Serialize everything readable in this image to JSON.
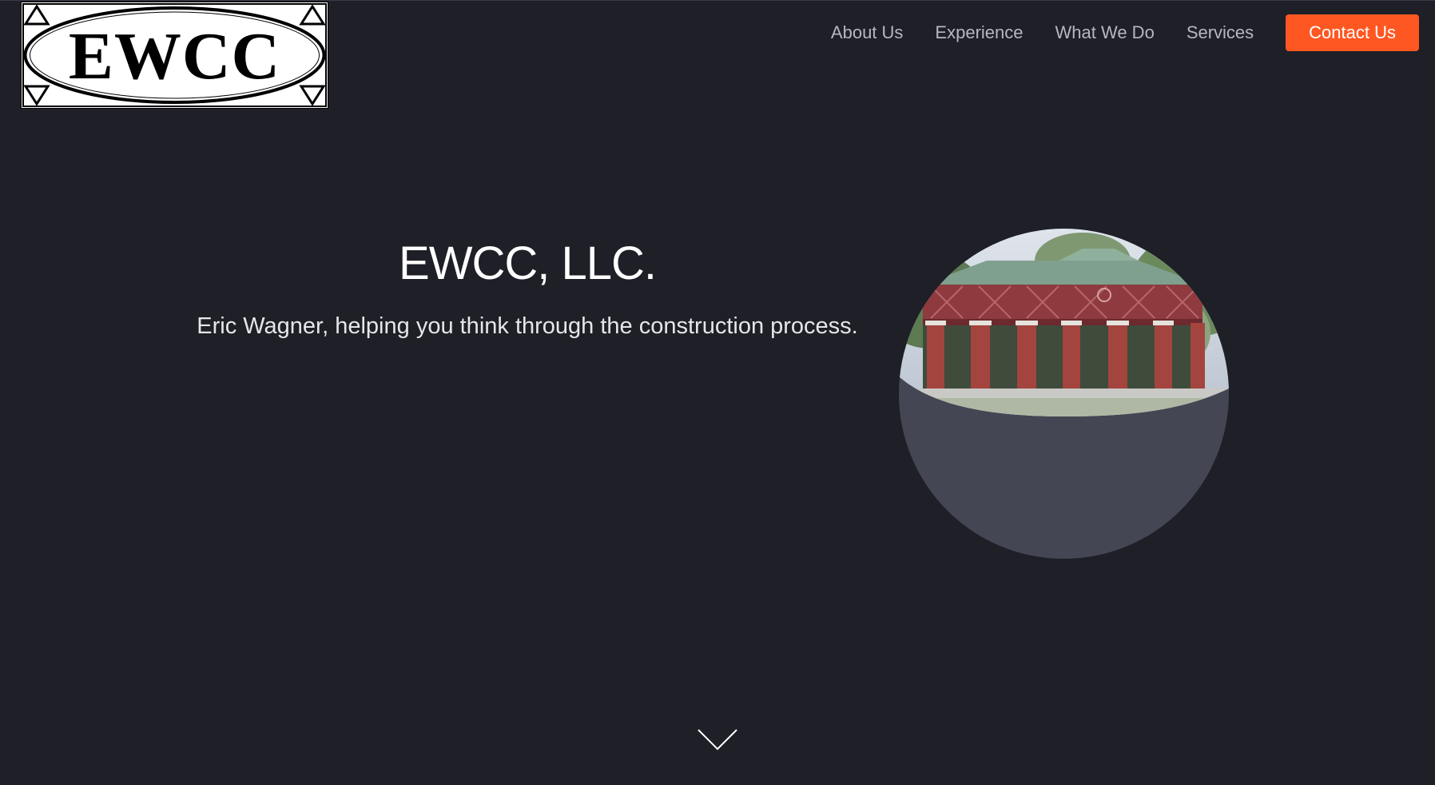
{
  "logo": {
    "text": "EWCC"
  },
  "nav": {
    "items": [
      {
        "label": "About Us"
      },
      {
        "label": "Experience"
      },
      {
        "label": "What We Do"
      },
      {
        "label": "Services"
      }
    ],
    "cta_label": "Contact Us"
  },
  "hero": {
    "title": "EWCC, LLC.",
    "subtitle": "Eric Wagner, helping you think through the construction process."
  },
  "colors": {
    "background": "#1e1f27",
    "accent": "#ff5722",
    "nav_text": "#b6b7c0",
    "circle_fill": "#454653"
  },
  "icons": {
    "scroll": "chevron-down-icon"
  }
}
